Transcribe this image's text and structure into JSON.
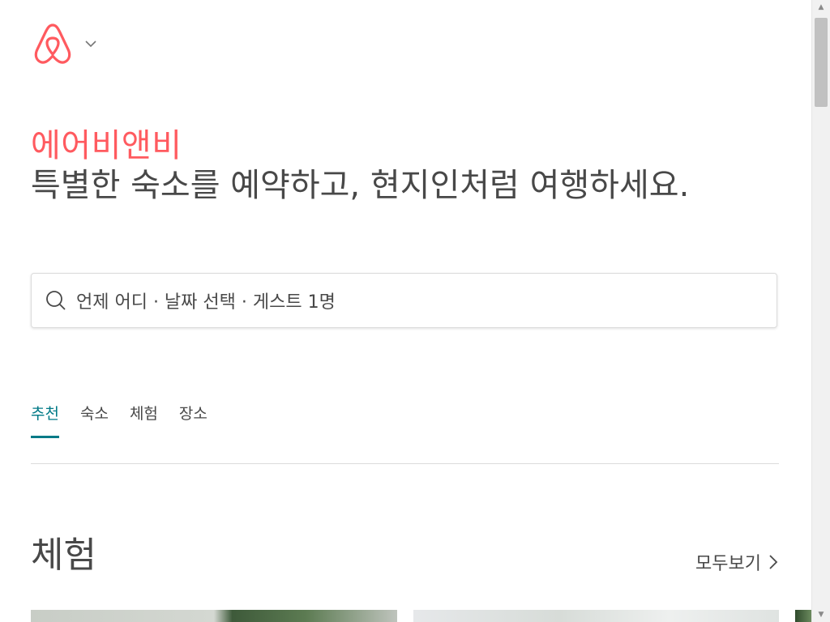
{
  "header": {
    "logo_icon": "airbnb-belo-icon",
    "dropdown_icon": "chevron-down-icon"
  },
  "hero": {
    "brand": "에어비앤비",
    "tagline": "특별한 숙소를 예약하고, 현지인처럼 여행하세요."
  },
  "search": {
    "icon": "search-icon",
    "summary": "언제 어디 · 날짜 선택 · 게스트 1명"
  },
  "tabs": [
    {
      "label": "추천",
      "active": true
    },
    {
      "label": "숙소",
      "active": false
    },
    {
      "label": "체험",
      "active": false
    },
    {
      "label": "장소",
      "active": false
    }
  ],
  "section": {
    "title": "체험",
    "see_all": "모두보기",
    "see_all_icon": "chevron-right-icon"
  },
  "colors": {
    "brand": "#ff5a5f",
    "accent": "#007a87",
    "text": "#484848"
  }
}
